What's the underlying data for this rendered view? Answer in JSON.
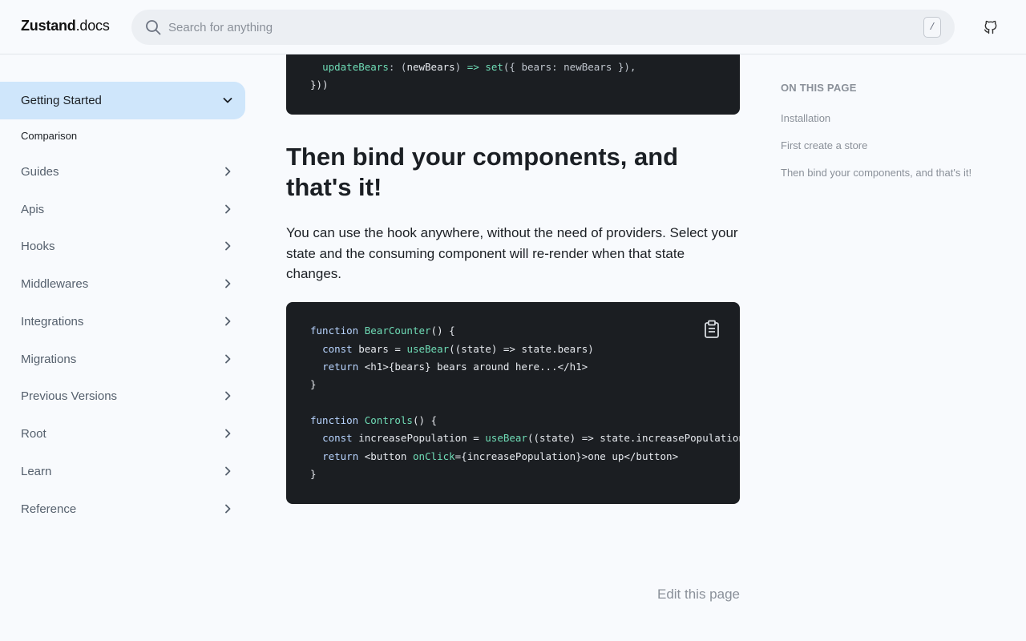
{
  "header": {
    "logo_brand": "Zustand",
    "logo_suffix": ".docs",
    "search_placeholder": "Search for anything",
    "search_shortcut": "/"
  },
  "sidebar": {
    "active_item": "Getting Started",
    "sub_item": "Comparison",
    "items": [
      {
        "label": "Guides"
      },
      {
        "label": "Apis"
      },
      {
        "label": "Hooks"
      },
      {
        "label": "Middlewares"
      },
      {
        "label": "Integrations"
      },
      {
        "label": "Migrations"
      },
      {
        "label": "Previous Versions"
      },
      {
        "label": "Root"
      },
      {
        "label": "Learn"
      },
      {
        "label": "Reference"
      }
    ]
  },
  "main": {
    "code_top": {
      "line1_prop": "updateBears",
      "line1_arg": "newBears",
      "line1_fn": "set",
      "line2": "}))"
    },
    "heading": "Then bind your components, and that's it!",
    "paragraph": "You can use the hook anywhere, without the need of providers. Select your state and the consuming component will re-render when that state changes.",
    "code_main": {
      "fn1_name": "BearCounter",
      "fn2_name": "Controls",
      "hook": "useBear"
    },
    "edit_link": "Edit this page"
  },
  "toc": {
    "title": "ON THIS PAGE",
    "items": [
      {
        "label": "Installation"
      },
      {
        "label": "First create a store"
      },
      {
        "label": "Then bind your components, and that's it!"
      }
    ]
  },
  "colors": {
    "active_nav_bg": "#cfe6fb",
    "code_bg": "#1b1e22",
    "code_fn": "#6fdcb6",
    "code_keyword": "#b8d4ff"
  }
}
